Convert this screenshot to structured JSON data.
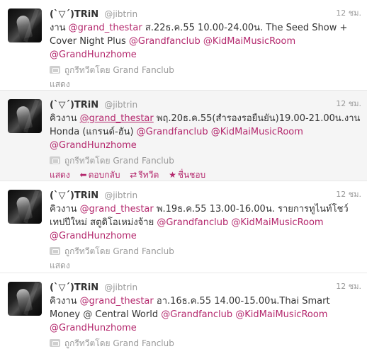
{
  "tweets": [
    {
      "name": "(`▽´)TRiN",
      "handle": "@jibtrin",
      "time": "12 ชม.",
      "segments": [
        {
          "type": "text",
          "value": "งาน "
        },
        {
          "type": "mention",
          "value": "@grand_thestar"
        },
        {
          "type": "text",
          "value": " ส.22ธ.ค.55 10.00-24.00น. The Seed Show + Cover Night Plus "
        },
        {
          "type": "mention",
          "value": "@Grandfanclub"
        },
        {
          "type": "text",
          "value": " "
        },
        {
          "type": "mention",
          "value": "@KidMaiMusicRoom"
        },
        {
          "type": "text",
          "value": " "
        },
        {
          "type": "mention",
          "value": "@GrandHunzhome"
        }
      ],
      "retweeted_by": "ถูกรีทวีตโดย Grand Fanclub",
      "show_label": "แสดง",
      "highlighted": false
    },
    {
      "name": "(`▽´)TRiN",
      "handle": "@jibtrin",
      "time": "12 ชม.",
      "segments": [
        {
          "type": "text",
          "value": "คิวงาน "
        },
        {
          "type": "mention",
          "value": "@grand_thestar",
          "underline": true
        },
        {
          "type": "text",
          "value": " พฤ.20ธ.ค.55(สำรองรอยืนยัน)19.00-21.00น.งาน Honda (แกรนด์-ฮัน) "
        },
        {
          "type": "mention",
          "value": "@Grandfanclub"
        },
        {
          "type": "text",
          "value": " "
        },
        {
          "type": "mention",
          "value": "@KidMaiMusicRoom"
        },
        {
          "type": "text",
          "value": " "
        },
        {
          "type": "mention",
          "value": "@GrandHunzhome"
        }
      ],
      "retweeted_by": "ถูกรีทวีตโดย Grand Fanclub",
      "show_label": "แสดง",
      "highlighted": true,
      "actions": {
        "reply": "ตอบกลับ",
        "retweet": "รีทวีต",
        "favorite": "ชื่นชอบ"
      }
    },
    {
      "name": "(`▽´)TRiN",
      "handle": "@jibtrin",
      "time": "12 ชม.",
      "segments": [
        {
          "type": "text",
          "value": "คิวงาน "
        },
        {
          "type": "mention",
          "value": "@grand_thestar"
        },
        {
          "type": "text",
          "value": " พ.19ธ.ค.55 13.00-16.00น. รายการทูไนท์โชว์ เทปปีใหม่ สตูดิโอเหม่งจ้าย "
        },
        {
          "type": "mention",
          "value": "@Grandfanclub"
        },
        {
          "type": "text",
          "value": " "
        },
        {
          "type": "mention",
          "value": "@KidMaiMusicRoom"
        },
        {
          "type": "text",
          "value": " "
        },
        {
          "type": "mention",
          "value": "@GrandHunzhome"
        }
      ],
      "retweeted_by": "ถูกรีทวีตโดย Grand Fanclub",
      "show_label": "แสดง",
      "highlighted": false
    },
    {
      "name": "(`▽´)TRiN",
      "handle": "@jibtrin",
      "time": "12 ชม.",
      "segments": [
        {
          "type": "text",
          "value": "คิวงาน "
        },
        {
          "type": "mention",
          "value": "@grand_thestar"
        },
        {
          "type": "text",
          "value": " อา.16ธ.ค.55 14.00-15.00น.Thai Smart Money @ Central World "
        },
        {
          "type": "mention",
          "value": "@Grandfanclub"
        },
        {
          "type": "text",
          "value": " "
        },
        {
          "type": "mention",
          "value": "@KidMaiMusicRoom"
        },
        {
          "type": "text",
          "value": " "
        },
        {
          "type": "mention",
          "value": "@GrandHunzhome"
        }
      ],
      "retweeted_by": "ถูกรีทวีตโดย Grand Fanclub",
      "highlighted": false
    }
  ],
  "icons": {
    "retweeted_by": "retweet-small-icon",
    "reply": "reply-arrow-icon",
    "retweet": "retweet-icon",
    "favorite": "star-icon"
  },
  "colors": {
    "link": "#b4286d",
    "meta": "#999999",
    "text": "#333333",
    "highlight_bg": "#f5f5f5"
  }
}
